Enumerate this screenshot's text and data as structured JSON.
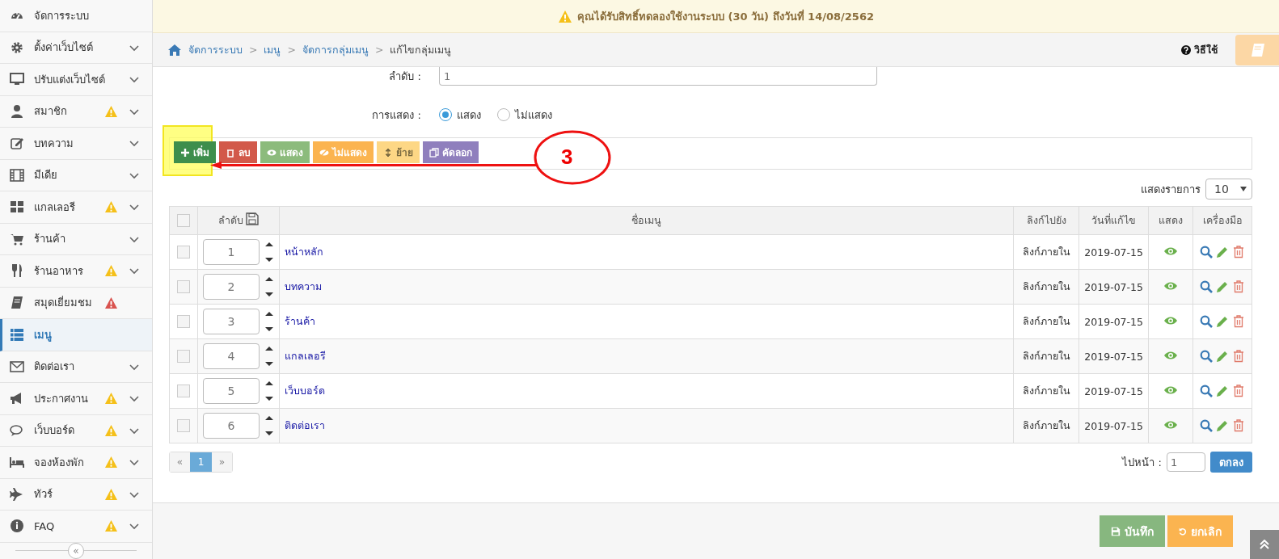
{
  "sidebar": {
    "items": [
      {
        "label": "จัดการระบบ",
        "expandable": false,
        "warning": false,
        "selected": false
      },
      {
        "label": "ตั้งค่าเว็บไซต์",
        "expandable": true,
        "warning": false,
        "selected": false
      },
      {
        "label": "ปรับแต่งเว็บไซต์",
        "expandable": true,
        "warning": false,
        "selected": false
      },
      {
        "label": "สมาชิก",
        "expandable": true,
        "warning": true,
        "color": "#f5c019",
        "selected": false
      },
      {
        "label": "บทความ",
        "expandable": true,
        "warning": false,
        "selected": false
      },
      {
        "label": "มีเดีย",
        "expandable": true,
        "warning": false,
        "selected": false
      },
      {
        "label": "แกลเลอรี",
        "expandable": true,
        "warning": true,
        "color": "#f5c019",
        "selected": false
      },
      {
        "label": "ร้านค้า",
        "expandable": true,
        "warning": false,
        "selected": false
      },
      {
        "label": "ร้านอาหาร",
        "expandable": true,
        "warning": true,
        "color": "#f5c019",
        "selected": false
      },
      {
        "label": "สมุดเยี่ยมชม",
        "expandable": false,
        "warning": true,
        "color": "#d9534f",
        "selected": false
      },
      {
        "label": "เมนู",
        "expandable": false,
        "warning": false,
        "selected": true
      },
      {
        "label": "ติดต่อเรา",
        "expandable": true,
        "warning": false,
        "selected": false
      },
      {
        "label": "ประกาศงาน",
        "expandable": true,
        "warning": true,
        "color": "#f5c019",
        "selected": false
      },
      {
        "label": "เว็บบอร์ด",
        "expandable": true,
        "warning": true,
        "color": "#f5c019",
        "selected": false
      },
      {
        "label": "จองห้องพัก",
        "expandable": true,
        "warning": true,
        "color": "#f5c019",
        "selected": false
      },
      {
        "label": "ทัวร์",
        "expandable": true,
        "warning": true,
        "color": "#f5c019",
        "selected": false
      },
      {
        "label": "FAQ",
        "expandable": true,
        "warning": true,
        "color": "#f5c019",
        "selected": false
      }
    ],
    "collapse": "«"
  },
  "notice": "คุณได้รับสิทธิ์ทดลองใช้งานระบบ (30 วัน) ถึงวันที่ 14/08/2562",
  "breadcrumb": [
    {
      "label": "จัดการระบบ",
      "kind": "link"
    },
    {
      "separator": ">",
      "label": "เมนู",
      "kind": "link"
    },
    {
      "separator": ">",
      "label": "จัดการกลุ่มเมนู",
      "kind": "link"
    },
    {
      "separator": ">",
      "label": "แก้ไขกลุ่มเมนู",
      "kind": "current"
    }
  ],
  "help": "วิธีใช้",
  "form": {
    "order_label": "ลำดับ :",
    "order_value": "1",
    "display_label": "การแสดง :",
    "display_options": [
      {
        "label": "แสดง",
        "selected": true
      },
      {
        "label": "ไม่แสดง",
        "selected": false
      }
    ]
  },
  "toolbar": [
    {
      "label": "เพิ่ม",
      "kind": "add"
    },
    {
      "label": "ลบ",
      "kind": "delete"
    },
    {
      "label": "แสดง",
      "kind": "show"
    },
    {
      "label": "ไม่แสดง",
      "kind": "hide"
    },
    {
      "label": "ย้าย",
      "kind": "move"
    },
    {
      "label": "คัดลอก",
      "kind": "copy"
    }
  ],
  "annotation": {
    "step": "3"
  },
  "page_size": {
    "label": "แสดงรายการ",
    "value": "10"
  },
  "table": {
    "header_checked": false,
    "columns": [
      "ลำดับ",
      "ชื่อเมนู",
      "ลิงก์ไปยัง",
      "วันที่แก้ไข",
      "แสดง",
      "เครื่องมือ"
    ],
    "rows": [
      {
        "checked": false,
        "order": "1",
        "name": "หน้าหลัก",
        "link": "ลิงก์ภายใน",
        "date": "2019-07-15",
        "visible": true
      },
      {
        "checked": false,
        "order": "2",
        "name": "บทความ",
        "link": "ลิงก์ภายใน",
        "date": "2019-07-15",
        "visible": true
      },
      {
        "checked": false,
        "order": "3",
        "name": "ร้านค้า",
        "link": "ลิงก์ภายใน",
        "date": "2019-07-15",
        "visible": true
      },
      {
        "checked": false,
        "order": "4",
        "name": "แกลเลอรี",
        "link": "ลิงก์ภายใน",
        "date": "2019-07-15",
        "visible": true
      },
      {
        "checked": false,
        "order": "5",
        "name": "เว็บบอร์ด",
        "link": "ลิงก์ภายใน",
        "date": "2019-07-15",
        "visible": true
      },
      {
        "checked": false,
        "order": "6",
        "name": "ติดต่อเรา",
        "link": "ลิงก์ภายใน",
        "date": "2019-07-15",
        "visible": true
      }
    ]
  },
  "pagination": {
    "prev": "«",
    "pages": [
      {
        "label": "1",
        "selected": true
      }
    ],
    "next": "»"
  },
  "goto": {
    "label": "ไปหน้า :",
    "value": "1",
    "button": "ตกลง"
  },
  "footer_buttons": [
    {
      "label": "บันทึก",
      "kind": "save"
    },
    {
      "label": "ยกเลิก",
      "kind": "cancel"
    }
  ]
}
